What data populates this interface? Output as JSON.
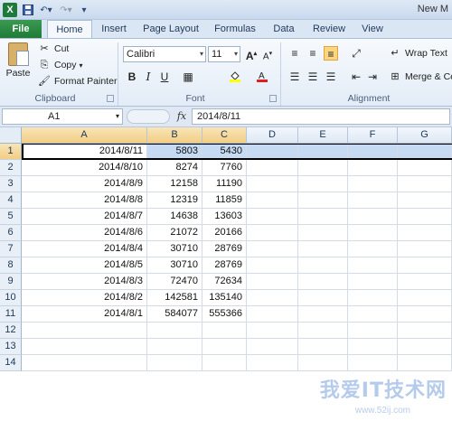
{
  "window": {
    "title": "New M"
  },
  "quick_access": {
    "app_icon": "X"
  },
  "tabs": [
    "File",
    "Home",
    "Insert",
    "Page Layout",
    "Formulas",
    "Data",
    "Review",
    "View"
  ],
  "ribbon": {
    "clipboard": {
      "paste": "Paste",
      "cut": "Cut",
      "copy": "Copy",
      "format_painter": "Format Painter",
      "label": "Clipboard"
    },
    "font": {
      "name": "Calibri",
      "size": "11",
      "bold": "B",
      "italic": "I",
      "underline": "U",
      "label": "Font"
    },
    "alignment": {
      "wrap_text": "Wrap Text",
      "merge": "Merge & Ce",
      "label": "Alignment"
    }
  },
  "formula_bar": {
    "name_box": "A1",
    "fx": "fx",
    "value": "2014/8/11"
  },
  "columns": [
    "A",
    "B",
    "C",
    "D",
    "E",
    "F",
    "G"
  ],
  "rows": [
    {
      "n": "1",
      "a": "2014/8/11",
      "b": "5803",
      "c": "5430"
    },
    {
      "n": "2",
      "a": "2014/8/10",
      "b": "8274",
      "c": "7760"
    },
    {
      "n": "3",
      "a": "2014/8/9",
      "b": "12158",
      "c": "11190"
    },
    {
      "n": "4",
      "a": "2014/8/8",
      "b": "12319",
      "c": "11859"
    },
    {
      "n": "5",
      "a": "2014/8/7",
      "b": "14638",
      "c": "13603"
    },
    {
      "n": "6",
      "a": "2014/8/6",
      "b": "21072",
      "c": "20166"
    },
    {
      "n": "7",
      "a": "2014/8/4",
      "b": "30710",
      "c": "28769"
    },
    {
      "n": "8",
      "a": "2014/8/5",
      "b": "30710",
      "c": "28769"
    },
    {
      "n": "9",
      "a": "2014/8/3",
      "b": "72470",
      "c": "72634"
    },
    {
      "n": "10",
      "a": "2014/8/2",
      "b": "142581",
      "c": "135140"
    },
    {
      "n": "11",
      "a": "2014/8/1",
      "b": "584077",
      "c": "555366"
    },
    {
      "n": "12",
      "a": "",
      "b": "",
      "c": ""
    },
    {
      "n": "13",
      "a": "",
      "b": "",
      "c": ""
    },
    {
      "n": "14",
      "a": "",
      "b": "",
      "c": ""
    }
  ],
  "watermark": {
    "text": "我爱IT技术网",
    "url": "www.52ij.com"
  },
  "colors": {
    "file_tab": "#1f7b37",
    "selection": "#c6dbf3",
    "header_selected": "#f2ce84"
  }
}
